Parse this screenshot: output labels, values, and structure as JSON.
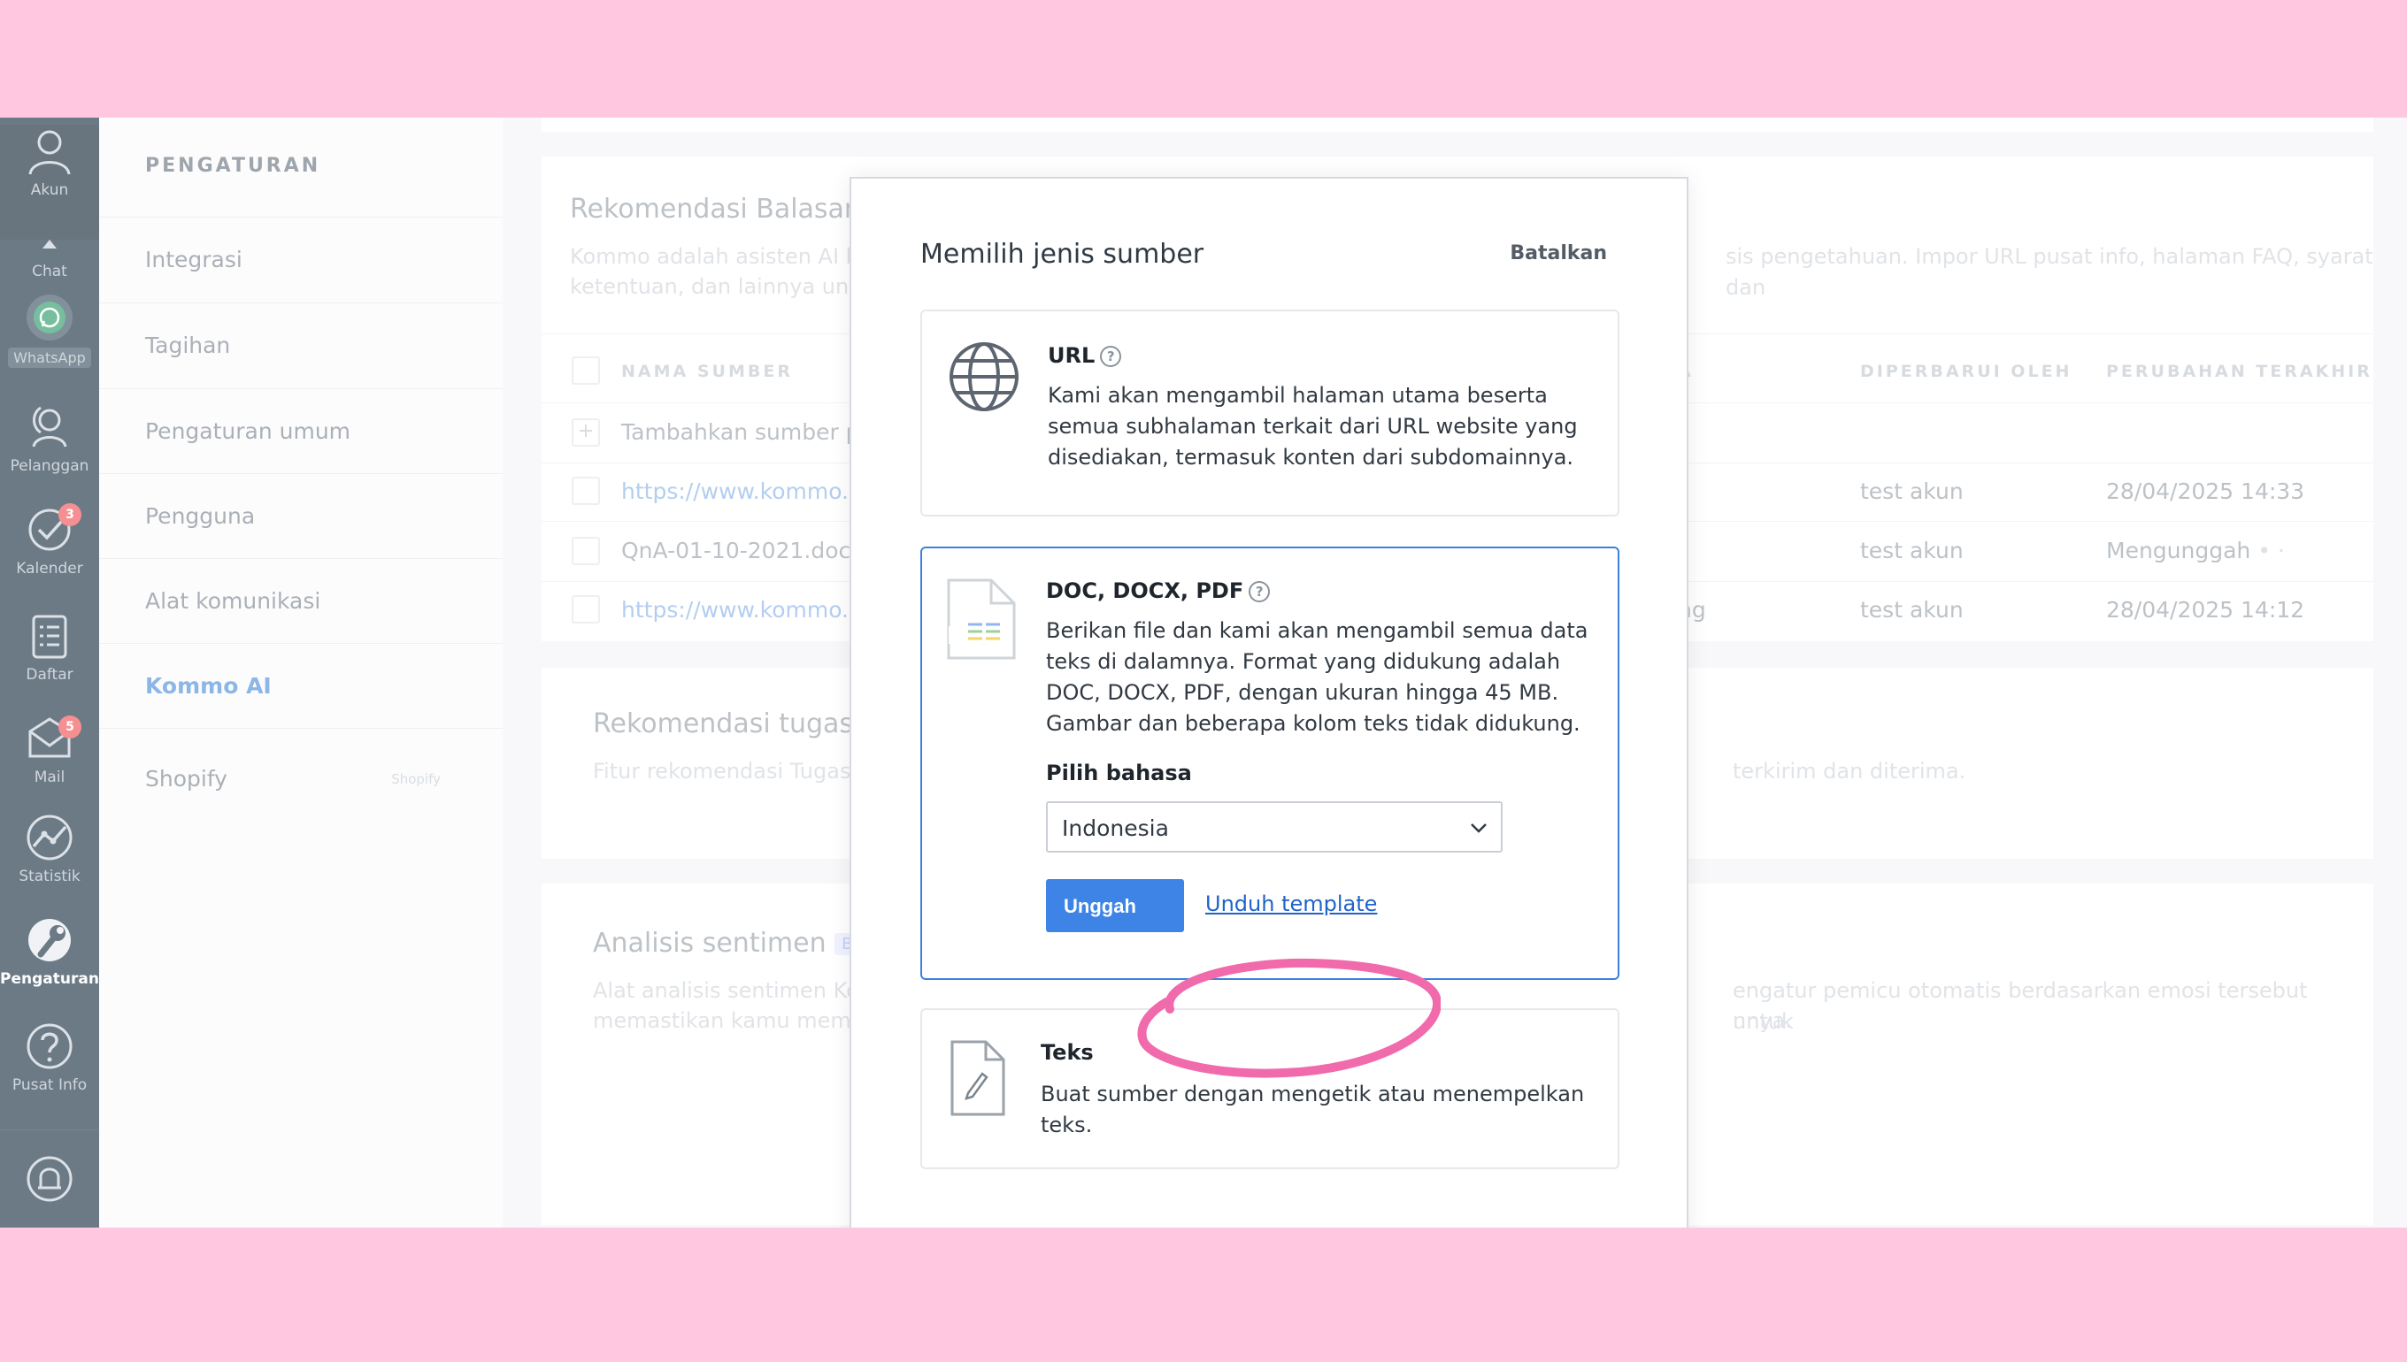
{
  "rail": {
    "items": [
      {
        "label": "Akun",
        "icon": "user-icon"
      },
      {
        "label": "Chat",
        "icon": "chevron-up-icon"
      },
      {
        "label": "WhatsApp",
        "icon": "whatsapp-icon"
      },
      {
        "label": "Pelanggan",
        "icon": "contacts-icon"
      },
      {
        "label": "Kalender",
        "icon": "check-circle-icon",
        "badge": "3"
      },
      {
        "label": "Daftar",
        "icon": "list-icon"
      },
      {
        "label": "Mail",
        "icon": "mail-icon",
        "badge": "5"
      },
      {
        "label": "Statistik",
        "icon": "stats-icon"
      },
      {
        "label": "Pengaturan",
        "icon": "settings-icon"
      },
      {
        "label": "Pusat Info",
        "icon": "help-icon"
      }
    ]
  },
  "settings": {
    "title": "PENGATURAN",
    "items": [
      {
        "label": "Integrasi"
      },
      {
        "label": "Tagihan"
      },
      {
        "label": "Pengaturan umum"
      },
      {
        "label": "Pengguna"
      },
      {
        "label": "Alat komunikasi"
      },
      {
        "label": "Kommo AI"
      },
      {
        "label": "Shopify",
        "hint": "Shopify"
      }
    ]
  },
  "content": {
    "reply_card": {
      "title": "Rekomendasi Balasan A",
      "desc_line1_left": "Kommo adalah asisten AI kar",
      "desc_line2_left": "ketentuan, dan lainnya untuk",
      "desc_line1_right": "sis pengetahuan. Impor URL pusat info, halaman FAQ, syarat dan",
      "columns": {
        "name": "NAMA SUMBER",
        "a": "A",
        "updated_by": "DIPERBARUI OLEH",
        "last_change": "PERUBAHAN TERAKHIR"
      },
      "add_source": "Tambahkan sumber per",
      "rows": [
        {
          "name": "https://www.kommo.co",
          "mid": "",
          "by": "test akun",
          "when": "28/04/2025 14:33"
        },
        {
          "name": "QnA-01-10-2021.docx",
          "mid": "",
          "by": "test akun",
          "when": "Mengunggah"
        },
        {
          "name": "https://www.kommo.co",
          "mid": "ng",
          "by": "test akun",
          "when": "28/04/2025 14:12"
        }
      ]
    },
    "task_card": {
      "title": "Rekomendasi tugas AI",
      "desc_left": "Fitur rekomendasi Tugas A",
      "desc_right": "terkirim dan diterima."
    },
    "sentiment_card": {
      "title": "Analisis sentimen",
      "beta": "Beta",
      "desc_line1_left": "Alat analisis sentimen Kon",
      "desc_line2_left": "memastikan kamu membe",
      "desc_line1_right": "engatur pemicu otomatis berdasarkan emosi tersebut untuk",
      "desc_line2_right": "nnya."
    }
  },
  "modal": {
    "title": "Memilih jenis sumber",
    "cancel": "Batalkan",
    "url_option": {
      "title": "URL",
      "desc": "Kami akan mengambil halaman utama beserta semua subhalaman terkait dari URL website yang disediakan, termasuk konten dari subdomainnya."
    },
    "doc_option": {
      "title": "DOC, DOCX, PDF",
      "desc": "Berikan file dan kami akan mengambil semua data teks di dalamnya. Format yang didukung adalah DOC, DOCX, PDF, dengan ukuran hingga 45 MB. Gambar dan beberapa kolom teks tidak didukung.",
      "lang_label": "Pilih bahasa",
      "lang_value": "Indonesia",
      "upload": "Unggah",
      "download": "Unduh template"
    },
    "text_option": {
      "title": "Teks",
      "desc": "Buat sumber dengan mengetik atau menempelkan teks."
    }
  },
  "colors": {
    "page_frame": "#ffc8e0",
    "rail": "#1e3445",
    "primary": "#3d84e6",
    "highlight": "#f06aac"
  }
}
